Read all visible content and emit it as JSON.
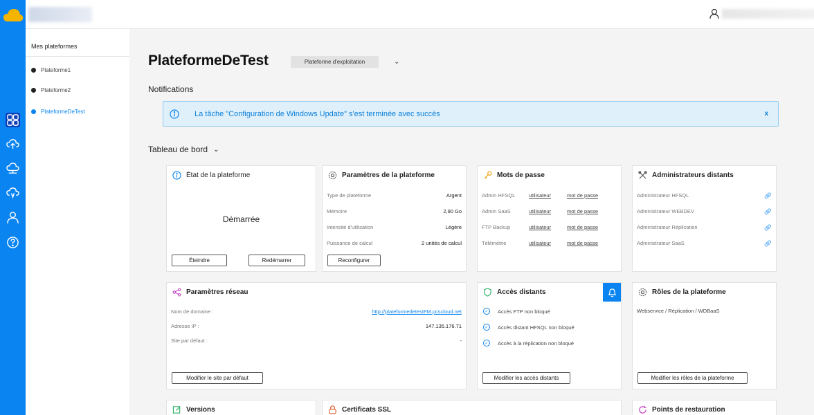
{
  "colors": {
    "accent": "#0a84f0",
    "banner_bg": "#dff0fb",
    "success": "#27ae60",
    "warning": "#f0a30a"
  },
  "sidebar": {
    "title": "Mes plateformes",
    "items": [
      {
        "label": "Plateforme1"
      },
      {
        "label": "Plateforme2"
      },
      {
        "label": "PlateformeDeTest"
      }
    ]
  },
  "header": {
    "title": "PlateformeDeTest",
    "platform_type": "Plateforme d'exploitation"
  },
  "notifications": {
    "title": "Notifications",
    "message": "La tâche \"Configuration de Windows Update\" s'est terminée avec succès",
    "close": "x"
  },
  "dashboard": {
    "title": "Tableau de bord"
  },
  "etat": {
    "title": "État de la plateforme",
    "status": "Démarrée",
    "btn_stop": "Éteindre",
    "btn_restart": "Redémarrer"
  },
  "params": {
    "title": "Paramètres de la plateforme",
    "rows": [
      {
        "k": "Type de plateforme",
        "v": "Argent"
      },
      {
        "k": "Mémoire",
        "v": "2,90 Go"
      },
      {
        "k": "Intensité d'utilisation",
        "v": "Légère"
      },
      {
        "k": "Puissance de calcul",
        "v": "2 unités de calcul"
      }
    ],
    "btn": "Reconfigurer"
  },
  "passwords": {
    "title": "Mots de passe",
    "rows": [
      {
        "k": "Admin HFSQL"
      },
      {
        "k": "Admin SaaS"
      },
      {
        "k": "FTP Backup"
      },
      {
        "k": "Télémétrie"
      }
    ],
    "user": "utilisateur",
    "pass": "mot de passe"
  },
  "admins": {
    "title": "Administrateurs distants",
    "rows": [
      {
        "k": "Administrateur HFSQL"
      },
      {
        "k": "Administrateur WEBDEV"
      },
      {
        "k": "Administrateur Réplication"
      },
      {
        "k": "Administrateur SaaS"
      }
    ]
  },
  "network": {
    "title": "Paramètres réseau",
    "rows": [
      {
        "k": "Nom de domaine :",
        "v": "http://plateformedetestFM.pcscloud.net"
      },
      {
        "k": "Adresse IP :",
        "v": "147.135.176.71"
      },
      {
        "k": "Site par défaut :",
        "v": "-"
      }
    ],
    "btn": "Modifier le site par défaut"
  },
  "access": {
    "title": "Accès distants",
    "rows": [
      {
        "t": "Accès FTP non bloqué"
      },
      {
        "t": "Accès distant HFSQL non bloqué"
      },
      {
        "t": "Accès à la réplication non bloqué"
      }
    ],
    "btn": "Modifier les accès distants"
  },
  "roles": {
    "title": "Rôles de la plateforme",
    "text": "Webservice / Réplication / WDBaaS",
    "btn": "Modifier les rôles de la plateforme"
  },
  "versions": {
    "title": "Versions"
  },
  "ssl": {
    "title": "Certificats SSL"
  },
  "restore": {
    "title": "Points de restauration"
  }
}
